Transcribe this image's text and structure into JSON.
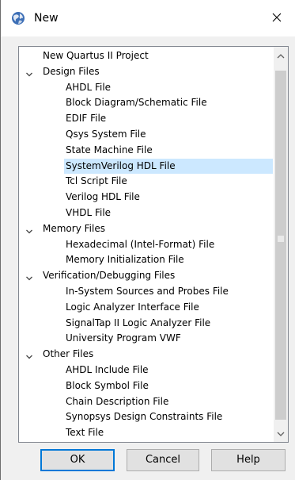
{
  "window": {
    "title": "New",
    "app_icon": "quartus-globe-icon",
    "close_icon": "close-icon"
  },
  "tree": {
    "items": [
      {
        "label": "New Quartus II Project",
        "level": 0,
        "expandable": false
      },
      {
        "label": "Design Files",
        "level": 0,
        "expandable": true,
        "expanded": true
      },
      {
        "label": "AHDL File",
        "level": 1
      },
      {
        "label": "Block Diagram/Schematic File",
        "level": 1
      },
      {
        "label": "EDIF File",
        "level": 1
      },
      {
        "label": "Qsys System File",
        "level": 1
      },
      {
        "label": "State Machine File",
        "level": 1
      },
      {
        "label": "SystemVerilog HDL File",
        "level": 1,
        "selected": true
      },
      {
        "label": "Tcl Script File",
        "level": 1
      },
      {
        "label": "Verilog HDL File",
        "level": 1
      },
      {
        "label": "VHDL File",
        "level": 1
      },
      {
        "label": "Memory Files",
        "level": 0,
        "expandable": true,
        "expanded": true
      },
      {
        "label": "Hexadecimal (Intel-Format) File",
        "level": 1
      },
      {
        "label": "Memory Initialization File",
        "level": 1
      },
      {
        "label": "Verification/Debugging Files",
        "level": 0,
        "expandable": true,
        "expanded": true
      },
      {
        "label": "In-System Sources and Probes File",
        "level": 1
      },
      {
        "label": "Logic Analyzer Interface File",
        "level": 1
      },
      {
        "label": "SignalTap II Logic Analyzer File",
        "level": 1
      },
      {
        "label": "University Program VWF",
        "level": 1
      },
      {
        "label": "Other Files",
        "level": 0,
        "expandable": true,
        "expanded": true
      },
      {
        "label": "AHDL Include File",
        "level": 1
      },
      {
        "label": "Block Symbol File",
        "level": 1
      },
      {
        "label": "Chain Description File",
        "level": 1
      },
      {
        "label": "Synopsys Design Constraints File",
        "level": 1
      },
      {
        "label": "Text File",
        "level": 1
      }
    ]
  },
  "buttons": {
    "ok": "OK",
    "cancel": "Cancel",
    "help": "Help"
  },
  "colors": {
    "selection": "#cce8ff",
    "default_button_border": "#0078d7",
    "dialog_background": "#f0f0f0",
    "scroll_thumb": "#cdcdcd"
  }
}
